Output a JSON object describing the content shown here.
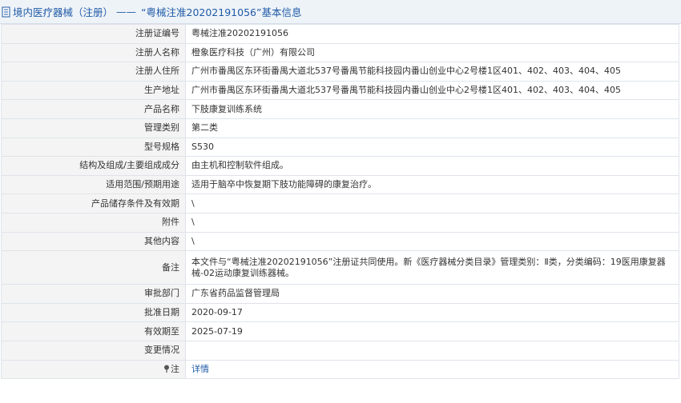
{
  "header": {
    "title_prefix": "境内医疗器械（注册）",
    "title_sep": "——",
    "title_main": "“粤械注准20202191056”基本信息"
  },
  "rows": [
    {
      "label": "注册证编号",
      "value": "粤械注准20202191056"
    },
    {
      "label": "注册人名称",
      "value": "橙象医疗科技（广州）有限公司"
    },
    {
      "label": "注册人住所",
      "value": "广州市番禺区东环街番禺大道北537号番禺节能科技园内番山创业中心2号楼1区401、402、403、404、405"
    },
    {
      "label": "生产地址",
      "value": "广州市番禺区东环街番禺大道北537号番禺节能科技园内番山创业中心2号楼1区401、402、403、404、405"
    },
    {
      "label": "产品名称",
      "value": "下肢康复训练系统"
    },
    {
      "label": "管理类别",
      "value": "第二类"
    },
    {
      "label": "型号规格",
      "value": "S530"
    },
    {
      "label": "结构及组成/主要组成成分",
      "value": "由主机和控制软件组成。"
    },
    {
      "label": "适用范围/预期用途",
      "value": "适用于脑卒中恢复期下肢功能障碍的康复治疗。"
    },
    {
      "label": "产品储存条件及有效期",
      "value": "\\"
    },
    {
      "label": "附件",
      "value": "\\"
    },
    {
      "label": "其他内容",
      "value": "\\"
    },
    {
      "label": "备注",
      "value": "本文件与“粤械注准20202191056”注册证共同使用。新《医疗器械分类目录》管理类别：Ⅱ类，分类编码：19医用康复器械-02运动康复训练器械。"
    },
    {
      "label": "审批部门",
      "value": "广东省药品监督管理局"
    },
    {
      "label": "批准日期",
      "value": "2020-09-17"
    },
    {
      "label": "有效期至",
      "value": "2025-07-19"
    },
    {
      "label": "变更情况",
      "value": ""
    },
    {
      "label": "注",
      "value": "详情"
    }
  ],
  "icons": {
    "header": "document-icon",
    "note": "pin-icon"
  }
}
